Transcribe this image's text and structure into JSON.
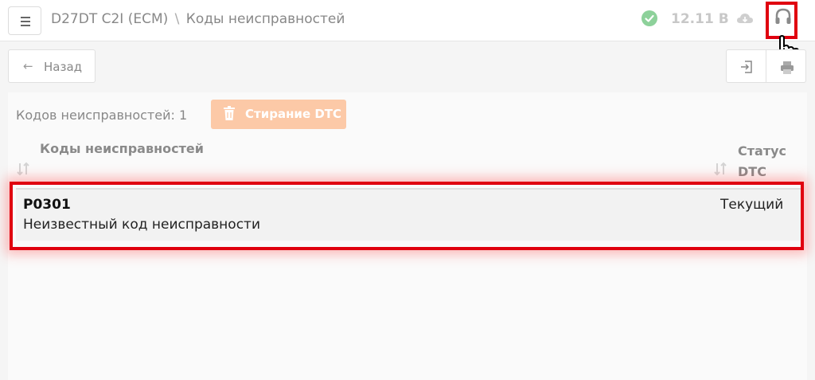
{
  "header": {
    "device": "D27DT C2I (ECM)",
    "separator": "\\",
    "page": "Коды неисправностей",
    "voltage": "12.11 В"
  },
  "toolbar": {
    "back_label": "Назад"
  },
  "summary": {
    "count_label": "Кодов неисправностей: 1",
    "erase_label": "Стирание DTC"
  },
  "table": {
    "col_codes": "Коды неисправностей",
    "col_status_line1": "Статус",
    "col_status_line2": "DTC",
    "rows": [
      {
        "code": "P0301",
        "description": "Неизвестный код неисправности",
        "status": "Текущий"
      }
    ]
  },
  "colors": {
    "highlight": "#e0000f",
    "erase_button": "#fcc9a7",
    "ok_status": "#8dd19a"
  },
  "icons": [
    "menu-icon",
    "check-circle-icon",
    "cloud-icon",
    "headset-icon",
    "hand-cursor-icon",
    "arrow-left-icon",
    "export-icon",
    "print-icon",
    "trash-icon",
    "sort-icon"
  ]
}
